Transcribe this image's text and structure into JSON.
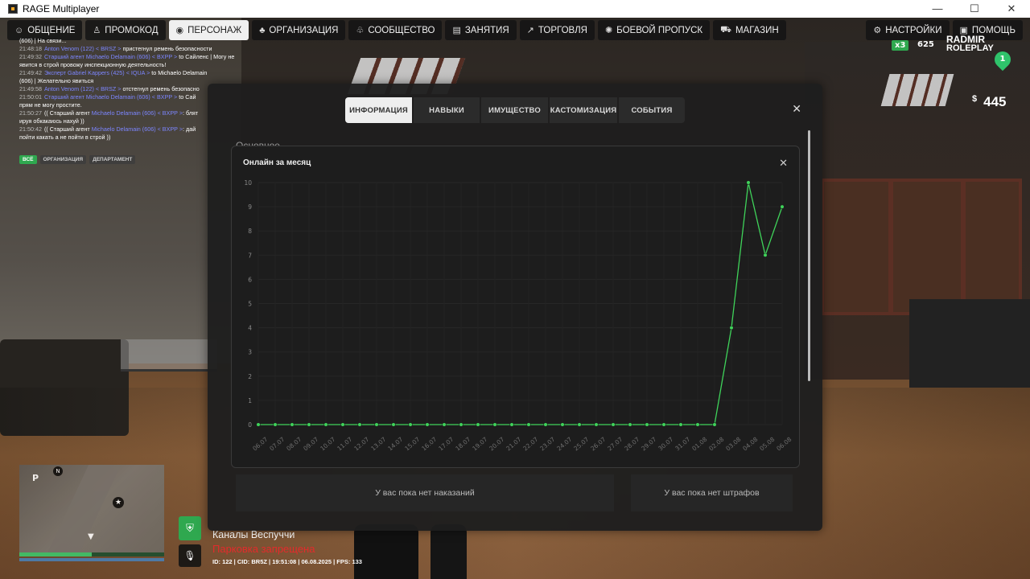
{
  "window": {
    "title": "RAGE Multiplayer",
    "minimize": "—",
    "maximize": "☐",
    "close": "✕"
  },
  "nav": {
    "left": [
      {
        "label": "ОБЩЕНИЕ",
        "icon": "☺"
      },
      {
        "label": "ПРОМОКОД",
        "icon": "♙"
      },
      {
        "label": "ПЕРСОНАЖ",
        "icon": "◉"
      },
      {
        "label": "ОРГАНИЗАЦИЯ",
        "icon": "♣"
      },
      {
        "label": "СООБЩЕСТВО",
        "icon": "♧"
      },
      {
        "label": "ЗАНЯТИЯ",
        "icon": "▤"
      },
      {
        "label": "ТОРГОВЛЯ",
        "icon": "↗"
      },
      {
        "label": "БОЕВОЙ ПРОПУСК",
        "icon": "✺"
      },
      {
        "label": "МАГАЗИН",
        "icon": "⛟"
      }
    ],
    "right": [
      {
        "label": "НАСТРОЙКИ",
        "icon": "⚙"
      },
      {
        "label": "ПОМОЩЬ",
        "icon": "▣"
      }
    ],
    "active": "ПЕРСОНАЖ"
  },
  "hud": {
    "logo_line1": "RADMIR",
    "logo_line2": "ROLEPLAY",
    "multiplier": "x3",
    "points": "625",
    "money_symbol": "$",
    "money": "445",
    "marker_count": "1"
  },
  "chat": {
    "lines": [
      {
        "parts": [
          {
            "t": "(606) | На связи...",
            "c": ""
          }
        ]
      },
      {
        "parts": [
          {
            "t": "21:48:18",
            "c": "ts"
          },
          {
            "t": "Anton Venom (122) < BRSZ >",
            "c": "nm"
          },
          {
            "t": " пристегнул ремень безопасности",
            "c": ""
          }
        ]
      },
      {
        "parts": [
          {
            "t": "21:49:32",
            "c": "ts"
          },
          {
            "t": "Старший агент Michaelo Delamain (606) < BXPP >",
            "c": "nm"
          },
          {
            "t": " to Сайленс | Могу не",
            "c": ""
          }
        ]
      },
      {
        "parts": [
          {
            "t": "явится в строй провожу инспекционную деятельность!",
            "c": ""
          }
        ]
      },
      {
        "parts": [
          {
            "t": "21:49:42",
            "c": "ts"
          },
          {
            "t": "Эксперт Gabriel Kappers (425) < IQUA >",
            "c": "nm"
          },
          {
            "t": " to Michaelo Delamain",
            "c": ""
          }
        ]
      },
      {
        "parts": [
          {
            "t": "(606) | Желательно явиться",
            "c": ""
          }
        ]
      },
      {
        "parts": [
          {
            "t": "21:49:58",
            "c": "ts"
          },
          {
            "t": "Anton Venom (122) < BRSZ >",
            "c": "nm"
          },
          {
            "t": " отстегнул ремень безопасно",
            "c": ""
          }
        ]
      },
      {
        "parts": [
          {
            "t": "21:50:01",
            "c": "ts"
          },
          {
            "t": "Старший агент Michaelo Delamain (606) < BXPP >",
            "c": "nm"
          },
          {
            "t": " to Сай",
            "c": ""
          }
        ]
      },
      {
        "parts": [
          {
            "t": "прям не могу простите.",
            "c": ""
          }
        ]
      },
      {
        "parts": [
          {
            "t": "21:50:27",
            "c": "ts"
          },
          {
            "t": "(( Старший агент ",
            "c": ""
          },
          {
            "t": "Michaelo Delamain (606) < BXPP >",
            "c": "nm"
          },
          {
            "t": ": блят",
            "c": ""
          }
        ]
      },
      {
        "parts": [
          {
            "t": "ируя обкакаюсь нахуй ))",
            "c": ""
          }
        ]
      },
      {
        "parts": [
          {
            "t": "21:50:42",
            "c": "ts"
          },
          {
            "t": "(( Старший агент ",
            "c": ""
          },
          {
            "t": "Michaelo Delamain (606) < BXPP >",
            "c": "nm"
          },
          {
            "t": ": дай",
            "c": ""
          }
        ]
      },
      {
        "parts": [
          {
            "t": "пойти какать а не пойти в строй ))",
            "c": ""
          }
        ]
      }
    ],
    "tabs": [
      "ВСЁ",
      "ОРГАНИЗАЦИЯ",
      "ДЕПАРТАМЕНТ"
    ]
  },
  "minimap": {
    "p": "P",
    "n": "N",
    "star": "★",
    "arrow": "▼",
    "health_pct": 50,
    "armor_pct": 100
  },
  "location": {
    "name": "Каналы Веспуччи",
    "parking": "Парковка запрещена",
    "status": "ID: 122 | CID: BR5Z | 19:51:08  | 06.08.2025 | FPS: 133"
  },
  "panel": {
    "tabs": [
      "ИНФОРМАЦИЯ",
      "НАВЫКИ",
      "ИМУЩЕСТВО",
      "КАСТОМИЗАЦИЯ",
      "СОБЫТИЯ"
    ],
    "active_tab": "ИНФОРМАЦИЯ",
    "section_heading": "Основное",
    "no_punishments": "У вас пока нет наказаний",
    "no_fines": "У вас пока нет штрафов"
  },
  "chart_data": {
    "type": "line",
    "title": "Онлайн за месяц",
    "color": "#3fd35a",
    "grid": true,
    "ylim": [
      0,
      10
    ],
    "yticks": [
      0,
      1,
      2,
      3,
      4,
      5,
      6,
      7,
      8,
      9,
      10
    ],
    "x": [
      "06.07",
      "07.07",
      "08.07",
      "09.07",
      "10.07",
      "11.07",
      "12.07",
      "13.07",
      "14.07",
      "15.07",
      "16.07",
      "17.07",
      "18.07",
      "19.07",
      "20.07",
      "21.07",
      "22.07",
      "23.07",
      "24.07",
      "25.07",
      "26.07",
      "27.07",
      "28.07",
      "29.07",
      "30.07",
      "31.07",
      "01.08",
      "02.08",
      "03.08",
      "04.08",
      "05.08",
      "06.08"
    ],
    "series": [
      {
        "values": [
          0,
          0,
          0,
          0,
          0,
          0,
          0,
          0,
          0,
          0,
          0,
          0,
          0,
          0,
          0,
          0,
          0,
          0,
          0,
          0,
          0,
          0,
          0,
          0,
          0,
          0,
          0,
          0,
          4,
          10,
          7,
          9
        ]
      }
    ]
  }
}
